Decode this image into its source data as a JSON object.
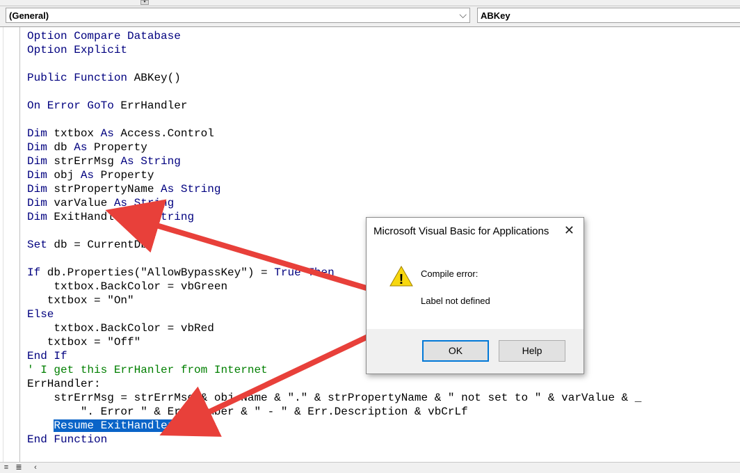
{
  "toolbar": {
    "grip_glyph": "▾"
  },
  "combos": {
    "object": {
      "value": "(General)",
      "arrow": "⌵"
    },
    "procedure": {
      "value": "ABKey"
    }
  },
  "code_lines": [
    {
      "parts": [
        {
          "t": "Option Compare Database",
          "c": "kw"
        }
      ]
    },
    {
      "parts": [
        {
          "t": "Option Explicit",
          "c": "kw"
        }
      ]
    },
    {
      "parts": []
    },
    {
      "parts": [
        {
          "t": "Public Function",
          "c": "kw"
        },
        {
          "t": " ABKey()"
        }
      ]
    },
    {
      "parts": []
    },
    {
      "parts": [
        {
          "t": "On Error GoTo",
          "c": "kw"
        },
        {
          "t": " ErrHandler"
        }
      ]
    },
    {
      "parts": []
    },
    {
      "parts": [
        {
          "t": "Dim",
          "c": "kw"
        },
        {
          "t": " txtbox "
        },
        {
          "t": "As",
          "c": "kw"
        },
        {
          "t": " Access.Control"
        }
      ]
    },
    {
      "parts": [
        {
          "t": "Dim",
          "c": "kw"
        },
        {
          "t": " db "
        },
        {
          "t": "As",
          "c": "kw"
        },
        {
          "t": " Property"
        }
      ]
    },
    {
      "parts": [
        {
          "t": "Dim",
          "c": "kw"
        },
        {
          "t": " strErrMsg "
        },
        {
          "t": "As String",
          "c": "kw"
        }
      ]
    },
    {
      "parts": [
        {
          "t": "Dim",
          "c": "kw"
        },
        {
          "t": " obj "
        },
        {
          "t": "As",
          "c": "kw"
        },
        {
          "t": " Property"
        }
      ]
    },
    {
      "parts": [
        {
          "t": "Dim",
          "c": "kw"
        },
        {
          "t": " strPropertyName "
        },
        {
          "t": "As String",
          "c": "kw"
        }
      ]
    },
    {
      "parts": [
        {
          "t": "Dim",
          "c": "kw"
        },
        {
          "t": " varValue "
        },
        {
          "t": "As String",
          "c": "kw"
        }
      ]
    },
    {
      "parts": [
        {
          "t": "Dim",
          "c": "kw"
        },
        {
          "t": " ExitHandler "
        },
        {
          "t": "As String",
          "c": "kw"
        }
      ]
    },
    {
      "parts": []
    },
    {
      "parts": [
        {
          "t": "Set",
          "c": "kw"
        },
        {
          "t": " db = CurrentDb"
        }
      ]
    },
    {
      "parts": []
    },
    {
      "parts": [
        {
          "t": "If",
          "c": "kw"
        },
        {
          "t": " db.Properties(\"AllowBypassKey\") = "
        },
        {
          "t": "True Then",
          "c": "kw"
        }
      ]
    },
    {
      "parts": [
        {
          "t": "    txtbox.BackColor = vbGreen"
        }
      ]
    },
    {
      "parts": [
        {
          "t": "   txtbox = \"On\""
        }
      ]
    },
    {
      "parts": [
        {
          "t": "Else",
          "c": "kw"
        }
      ]
    },
    {
      "parts": [
        {
          "t": "    txtbox.BackColor = vbRed"
        }
      ]
    },
    {
      "parts": [
        {
          "t": "   txtbox = \"Off\""
        }
      ]
    },
    {
      "parts": [
        {
          "t": "End If",
          "c": "kw"
        }
      ]
    },
    {
      "parts": [
        {
          "t": "' I get this ErrHanler from Internet",
          "c": "cm"
        }
      ]
    },
    {
      "parts": [
        {
          "t": "ErrHandler:"
        }
      ]
    },
    {
      "parts": [
        {
          "t": "    strErrMsg = strErrMsg & obj.Name & \".\" & strPropertyName & \" not set to \" & varValue & _"
        }
      ]
    },
    {
      "parts": [
        {
          "t": "        \". Error \" & Err.Number & \" - \" & Err.Description & vbCrLf"
        }
      ]
    },
    {
      "parts": [
        {
          "t": "    "
        },
        {
          "t": "Resume ExitHandler",
          "c": "sel"
        }
      ]
    },
    {
      "parts": [
        {
          "t": "End Function",
          "c": "kw"
        }
      ]
    }
  ],
  "dialog": {
    "title": "Microsoft Visual Basic for Applications",
    "close_glyph": "✕",
    "heading": "Compile error:",
    "message": "Label not defined",
    "ok_label": "OK",
    "help_label": "Help",
    "warn_glyph": "!"
  },
  "scrollbar": {
    "left_glyph": "‹"
  },
  "colors": {
    "keyword": "#00007f",
    "comment": "#007f00",
    "selection": "#0a64c8",
    "annotation_arrow": "#e8403a",
    "warning": "#f7d70f"
  }
}
